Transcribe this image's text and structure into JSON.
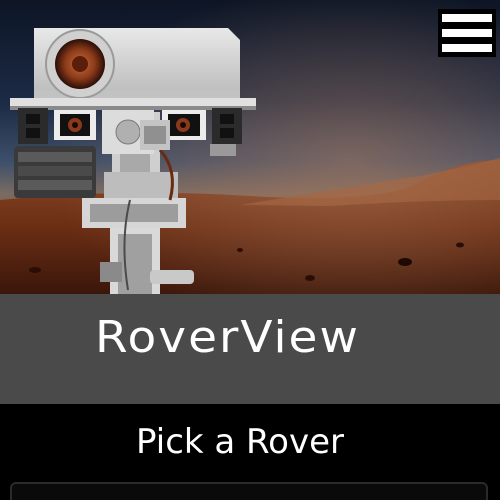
{
  "hero": {
    "image": "mars-rover-mastcam-photo"
  },
  "nav": {
    "menu_icon": "hamburger-menu-icon"
  },
  "brand": {
    "title": "RoverView"
  },
  "rover_picker": {
    "label": "Pick a Rover"
  },
  "colors": {
    "title_band": "#4a4a4a",
    "page_background": "#000000",
    "text": "#ffffff"
  }
}
